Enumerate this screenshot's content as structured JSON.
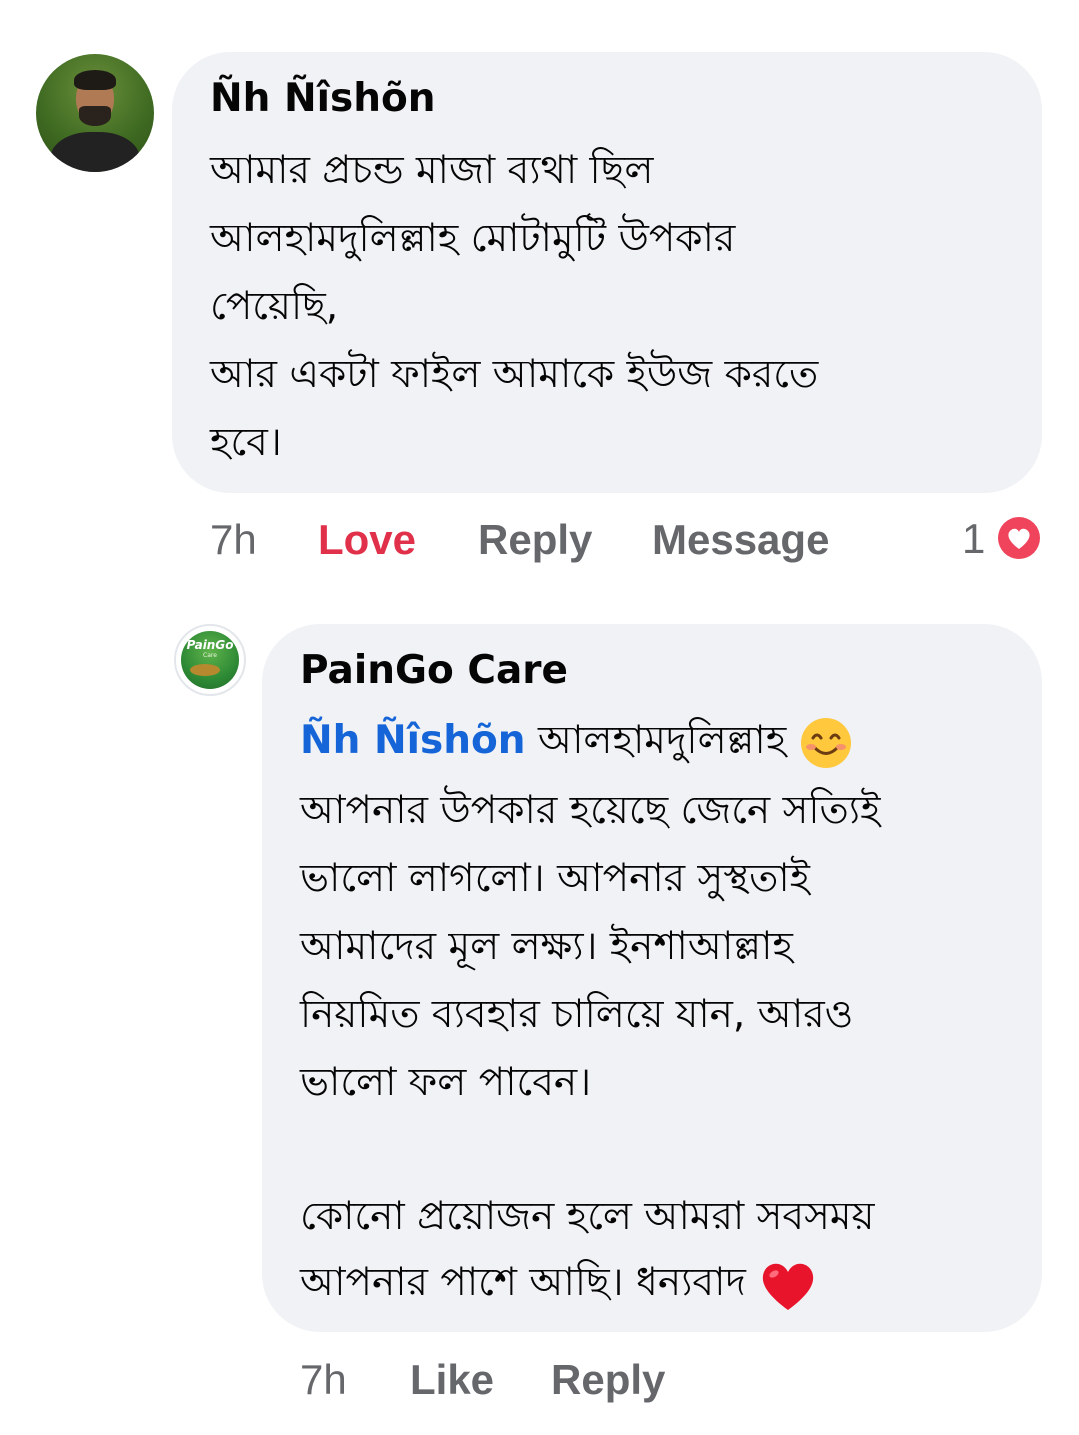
{
  "comment": {
    "author": "Ñh Ñîshõn",
    "lines": [
      "আমার প্রচন্ড মাজা ব্যথা ছিল",
      "আলহামদুলিল্লাহ মোটামুটি উপকার",
      "পেয়েছি,",
      "আর একটা ফাইল আমাকে ইউজ করতে",
      "হবে।"
    ],
    "time": "7h",
    "actions": {
      "love": "Love",
      "reply": "Reply",
      "message": "Message"
    },
    "reaction_count": "1",
    "reaction_icon": "love-reaction-icon",
    "love_color": "#e0304a"
  },
  "reply": {
    "author": "PainGo Care",
    "logo_text": "PainGo",
    "logo_sub": "Care",
    "mention": "Ñh Ñîshõn",
    "first_line_rest": "আলহামদুলিল্লাহ",
    "first_line_emoji": "smiling-face-emoji",
    "lines": [
      "আপনার উপকার হয়েছে জেনে সত্যিই",
      "ভালো লাগলো। আপনার সুস্থতাই",
      "আমাদের মূল লক্ষ্য। ইনশাআল্লাহ",
      "নিয়মিত ব্যবহার চালিয়ে যান, আরও",
      "ভালো ফল পাবেন।"
    ],
    "closing_lines": [
      "কোনো প্রয়োজন হলে আমরা সবসময়",
      "আপনার পাশে আছি। ধন্যবাদ"
    ],
    "closing_emoji": "red-heart-emoji",
    "time": "7h",
    "actions": {
      "like": "Like",
      "reply": "Reply"
    },
    "mention_color": "#1565d8"
  },
  "colors": {
    "bubble": "#f0f2f5",
    "meta_text": "#65676b",
    "body_text": "#050505"
  }
}
